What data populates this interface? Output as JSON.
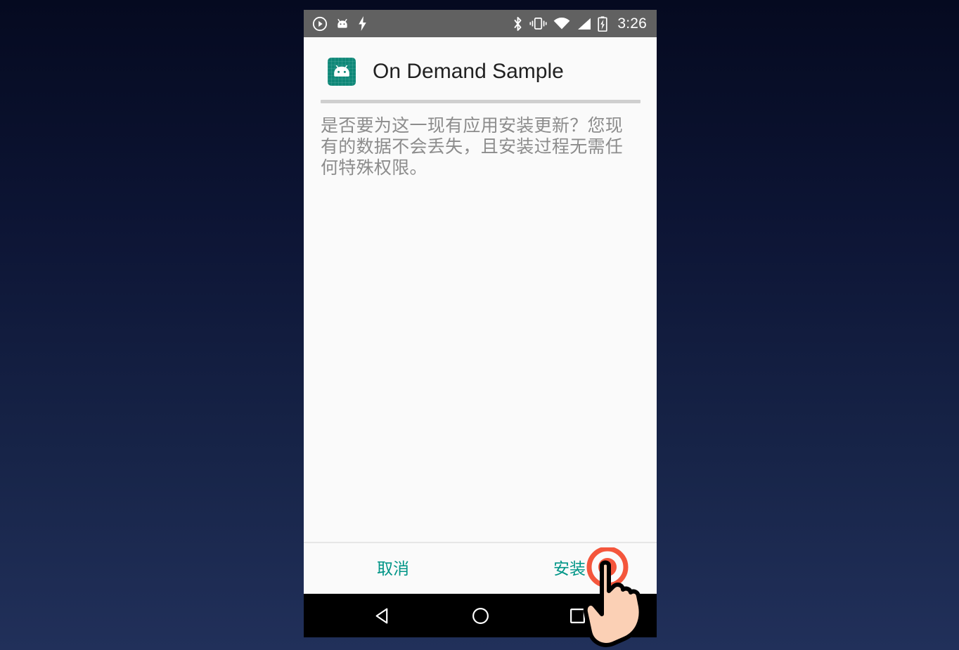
{
  "statusbar": {
    "left_icons": [
      {
        "name": "play-circle-icon",
        "label": "screen-record"
      },
      {
        "name": "android-head-icon",
        "label": "android"
      },
      {
        "name": "bolt-icon",
        "label": "charging"
      }
    ],
    "right_icons": [
      {
        "name": "bluetooth-icon",
        "label": "bluetooth"
      },
      {
        "name": "vibrate-icon",
        "label": "vibrate"
      },
      {
        "name": "wifi-icon",
        "label": "wifi"
      },
      {
        "name": "cellular-signal-icon",
        "label": "signal"
      },
      {
        "name": "battery-charging-icon",
        "label": "battery"
      }
    ],
    "clock": "3:26",
    "background_color": "#616161",
    "foreground_color": "#ffffff"
  },
  "app": {
    "title": "On Demand Sample",
    "icon_name": "android-app-icon",
    "icon_color": "#0f8878"
  },
  "dialog": {
    "message": "是否要为这一现有应用安装更新？您现有的数据不会丢失，且安装过程无需任何特殊权限。",
    "buttons": {
      "cancel_label": "取消",
      "install_label": "安装",
      "accent_color": "#009587"
    }
  },
  "navbar": {
    "back_label": "返回",
    "home_label": "主屏幕",
    "recents_label": "最近任务",
    "background_color": "#000000"
  },
  "cursor": {
    "type": "tap-cursor",
    "ring_color": "#f4563c",
    "hand_color": "#fbd0b5",
    "target": "install-button"
  },
  "desktop": {
    "background_top_color": "#050a20",
    "background_bottom_color": "#21305a"
  }
}
